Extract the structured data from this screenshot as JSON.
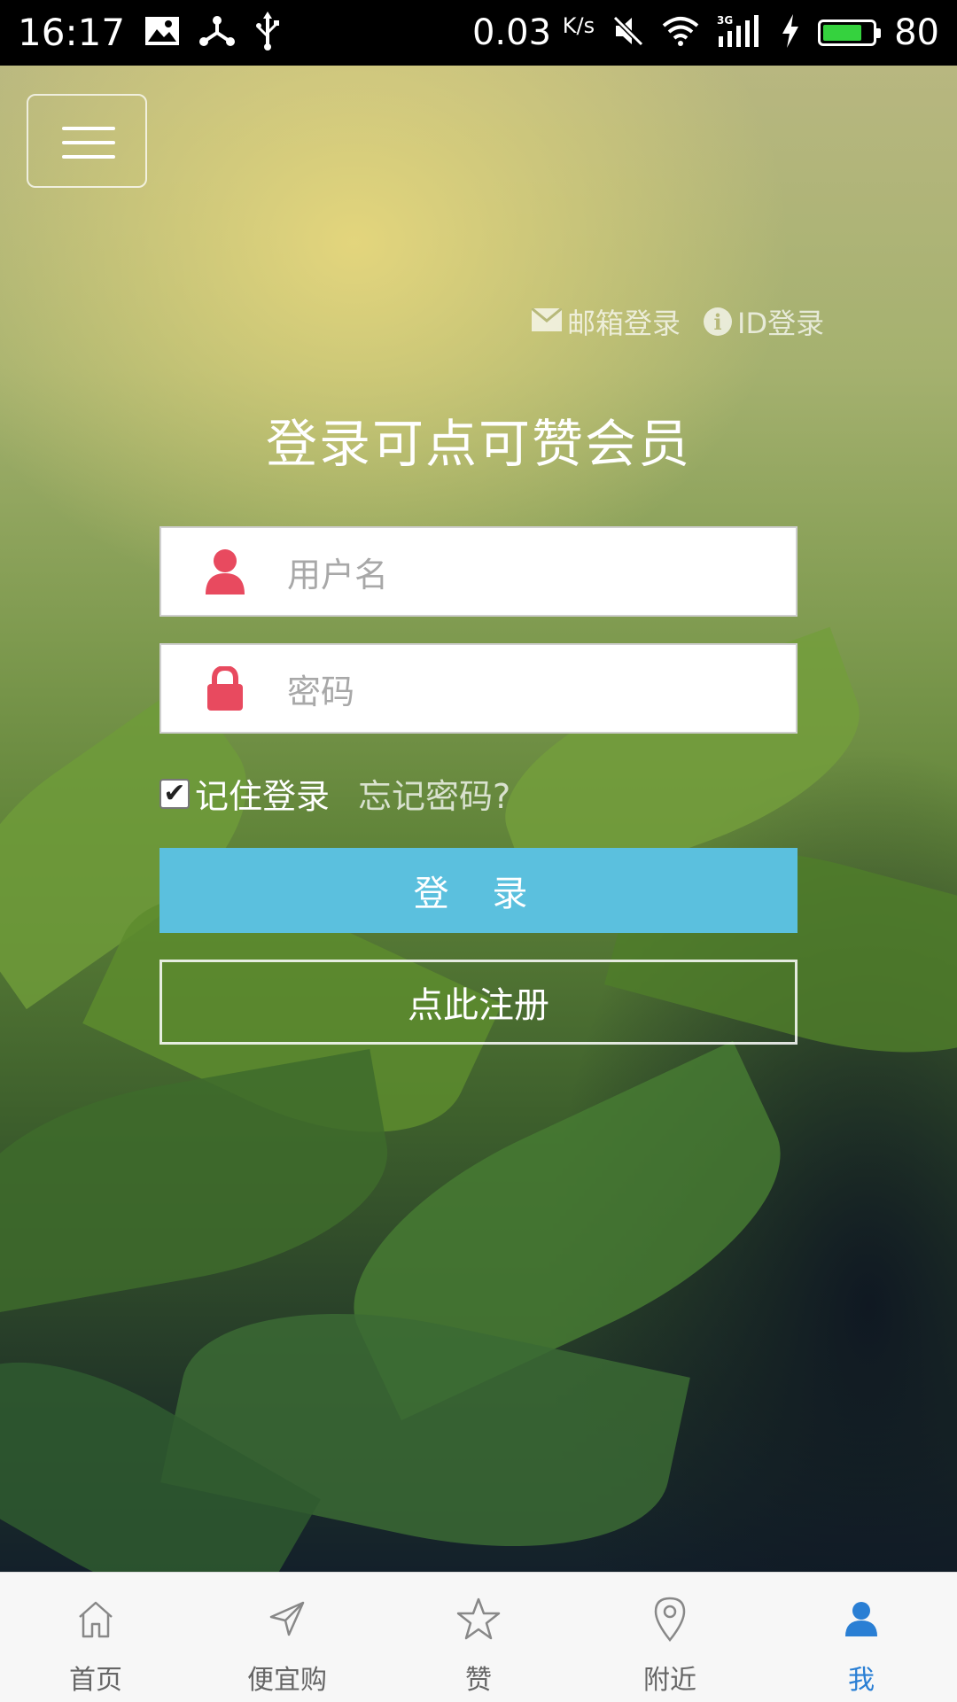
{
  "status_bar": {
    "time": "16:17",
    "speed": "0.03",
    "speed_unit": "K/s",
    "battery": "80",
    "battery_level": 0.8,
    "icons": [
      "image-icon",
      "share-icon",
      "usb-icon",
      "mute-icon",
      "wifi-icon",
      "signal-3g-icon",
      "charging-icon",
      "battery-icon"
    ]
  },
  "header": {
    "menu_icon": "hamburger-icon"
  },
  "login_options": {
    "email_login": "邮箱登录",
    "id_login": "ID登录"
  },
  "title": "登录可点可赞会员",
  "form": {
    "username_placeholder": "用户名",
    "password_placeholder": "密码",
    "remember_label": "记住登录",
    "remember_checked": true,
    "forgot_label": "忘记密码?",
    "login_button": "登 录",
    "register_button": "点此注册"
  },
  "colors": {
    "accent_icon": "#e84a5f",
    "login_button": "#5bc0de",
    "active_tab": "#2a7fd4"
  },
  "tabbar": {
    "tabs": [
      {
        "label": "首页",
        "icon": "home-icon"
      },
      {
        "label": "便宜购",
        "icon": "send-icon"
      },
      {
        "label": "赞",
        "icon": "star-icon"
      },
      {
        "label": "附近",
        "icon": "location-pin-icon"
      },
      {
        "label": "我",
        "icon": "user-icon",
        "active": true
      }
    ]
  }
}
